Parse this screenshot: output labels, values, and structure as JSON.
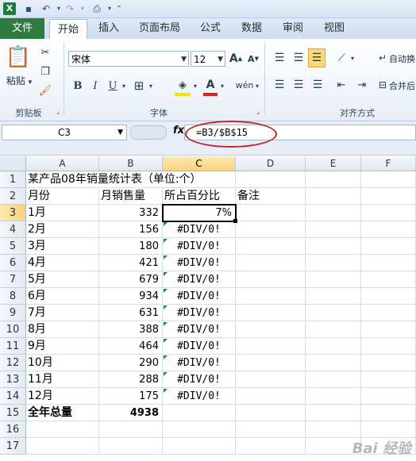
{
  "tabs": {
    "file": "文件",
    "items": [
      "开始",
      "插入",
      "页面布局",
      "公式",
      "数据",
      "审阅",
      "视图"
    ]
  },
  "ribbon": {
    "clipboard_label": "剪贴板",
    "paste_label": "粘贴",
    "font_label": "字体",
    "align_label": "对齐方式",
    "font_name": "宋体",
    "font_size": "12",
    "wrap_text": "自动换",
    "merge_center": "合并后"
  },
  "formula_bar": {
    "name_box": "C3",
    "fx": "fx",
    "formula": "=B3/$B$15"
  },
  "columns": [
    "A",
    "B",
    "C",
    "D",
    "E",
    "F"
  ],
  "rows": [
    {
      "n": "1",
      "a": "某产品08年销量统计表（单位:个）",
      "b": "",
      "c": ""
    },
    {
      "n": "2",
      "a": "月份",
      "b": "月销售量",
      "c": "所占百分比",
      "d": "备注"
    },
    {
      "n": "3",
      "a": "1月",
      "b": "332",
      "c": "7%"
    },
    {
      "n": "4",
      "a": "2月",
      "b": "156",
      "c": "#DIV/0!"
    },
    {
      "n": "5",
      "a": "3月",
      "b": "180",
      "c": "#DIV/0!"
    },
    {
      "n": "6",
      "a": "4月",
      "b": "421",
      "c": "#DIV/0!"
    },
    {
      "n": "7",
      "a": "5月",
      "b": "679",
      "c": "#DIV/0!"
    },
    {
      "n": "8",
      "a": "6月",
      "b": "934",
      "c": "#DIV/0!"
    },
    {
      "n": "9",
      "a": "7月",
      "b": "631",
      "c": "#DIV/0!"
    },
    {
      "n": "10",
      "a": "8月",
      "b": "388",
      "c": "#DIV/0!"
    },
    {
      "n": "11",
      "a": "9月",
      "b": "464",
      "c": "#DIV/0!"
    },
    {
      "n": "12",
      "a": "10月",
      "b": "290",
      "c": "#DIV/0!"
    },
    {
      "n": "13",
      "a": "11月",
      "b": "288",
      "c": "#DIV/0!"
    },
    {
      "n": "14",
      "a": "12月",
      "b": "175",
      "c": "#DIV/0!"
    },
    {
      "n": "15",
      "a": "全年总量",
      "b": "4938",
      "c": ""
    },
    {
      "n": "16",
      "a": "",
      "b": "",
      "c": ""
    },
    {
      "n": "17",
      "a": "",
      "b": "",
      "c": ""
    }
  ],
  "watermark": "Bai 经验"
}
